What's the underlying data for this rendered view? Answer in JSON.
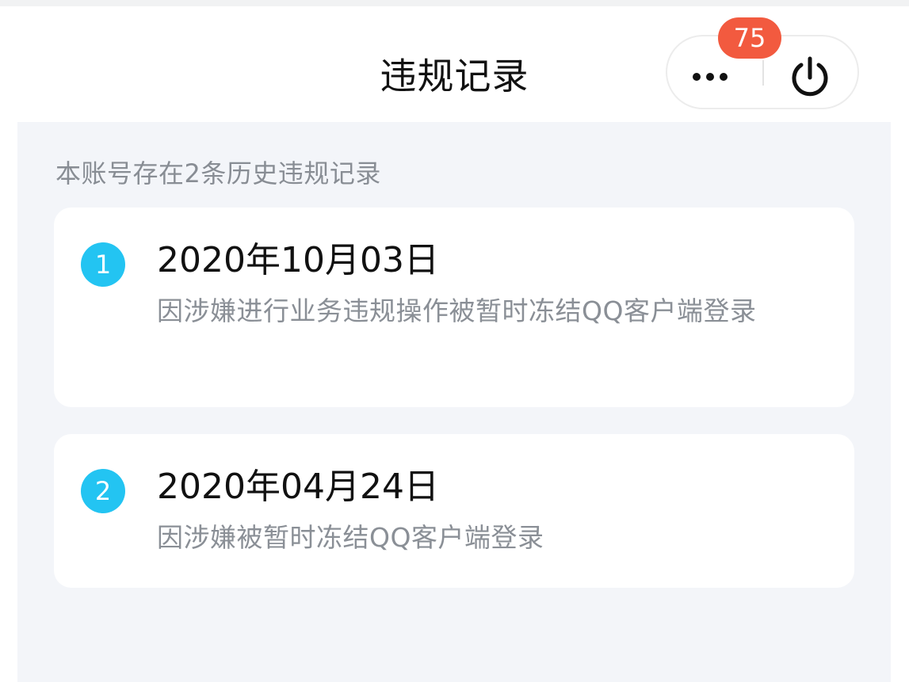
{
  "header": {
    "title": "违规记录",
    "badge_count": "75",
    "more_icon": "more-dots-icon",
    "power_icon": "power-icon"
  },
  "summary": "本账号存在2条历史违规记录",
  "records": [
    {
      "index": "1",
      "date": "2020年10月03日",
      "description": "因涉嫌进行业务违规操作被暂时冻结QQ客户端登录"
    },
    {
      "index": "2",
      "date": "2020年04月24日",
      "description": "因涉嫌被暂时冻结QQ客户端登录"
    }
  ],
  "colors": {
    "accent": "#23c4f2",
    "badge": "#f25a3f",
    "background": "#f3f5f9"
  }
}
